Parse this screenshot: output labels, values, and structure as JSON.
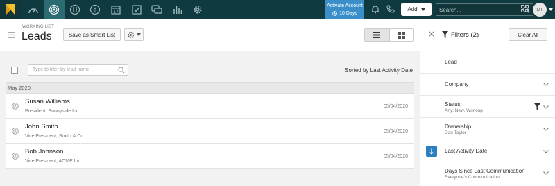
{
  "topnav": {
    "activate_label": "Activate Account",
    "days_label": "10 Days",
    "add_label": "Add",
    "search_placeholder": "Search...",
    "avatar_initials": "DT"
  },
  "header": {
    "subtitle": "WORKING LIST",
    "title": "Leads",
    "smart_list_label": "Save as Smart List"
  },
  "list": {
    "filter_placeholder": "Type to filter by lead name",
    "sorted_label": "Sorted by Last Activity Date",
    "group_label": "May 2020",
    "rows": [
      {
        "name": "Susan Williams",
        "subtitle": "President, Sunnyside Inc",
        "date": "05/04/2020"
      },
      {
        "name": "John Smith",
        "subtitle": "Vice President, Smith & Co",
        "date": "05/04/2020"
      },
      {
        "name": "Bob Johnson",
        "subtitle": "Vice President, ACME Inc",
        "date": "05/04/2020"
      }
    ]
  },
  "filters": {
    "title": "Filters (2)",
    "clear_label": "Clear All",
    "items": [
      {
        "label": "Lead",
        "value": ""
      },
      {
        "label": "Company",
        "value": ""
      },
      {
        "label": "Status",
        "value": "Any: New, Working"
      },
      {
        "label": "Ownership",
        "value": "Dan Taylor"
      },
      {
        "label": "Last Activity Date",
        "value": ""
      },
      {
        "label": "Days Since Last Communication",
        "value": "Everyone's Communication"
      }
    ]
  },
  "colors": {
    "nav_bg": "#0f3b40",
    "nav_active": "#2b6b72",
    "accent_blue": "#3a8fcb",
    "logo_yellow": "#f2c12e"
  }
}
